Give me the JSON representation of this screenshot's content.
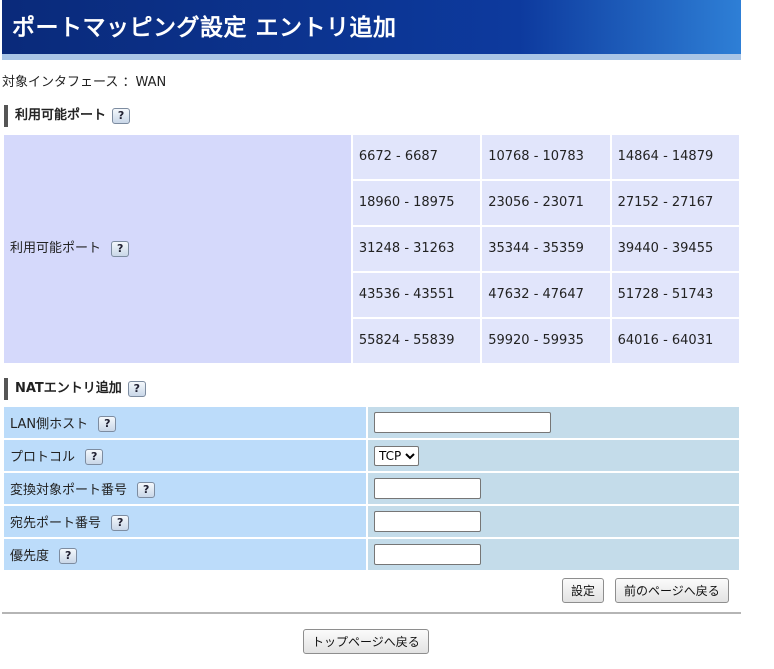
{
  "header": {
    "title": "ポートマッピング設定 エントリ追加"
  },
  "target_interface": "対象インタフェース ：WAN",
  "available_section": {
    "heading": "利用可能ポート",
    "row_label": "利用可能ポート",
    "ports": [
      [
        "6672 - 6687",
        "10768 - 10783",
        "14864 - 14879"
      ],
      [
        "18960 - 18975",
        "23056 - 23071",
        "27152 - 27167"
      ],
      [
        "31248 - 31263",
        "35344 - 35359",
        "39440 - 39455"
      ],
      [
        "43536 - 43551",
        "47632 - 47647",
        "51728 - 51743"
      ],
      [
        "55824 - 55839",
        "59920 - 59935",
        "64016 - 64031"
      ]
    ]
  },
  "nat_section": {
    "heading": "NATエントリ追加",
    "lan_host_label": "LAN側ホスト",
    "lan_host_value": "",
    "protocol_label": "プロトコル",
    "protocol_value": "TCP",
    "convert_port_label": "変換対象ポート番号",
    "convert_port_value": "",
    "dest_port_label": "宛先ポート番号",
    "dest_port_value": "",
    "priority_label": "優先度",
    "priority_value": ""
  },
  "help_icon_text": "?",
  "buttons": {
    "set": "設定",
    "back": "前のページへ戻る",
    "top": "トップページへ戻る"
  }
}
